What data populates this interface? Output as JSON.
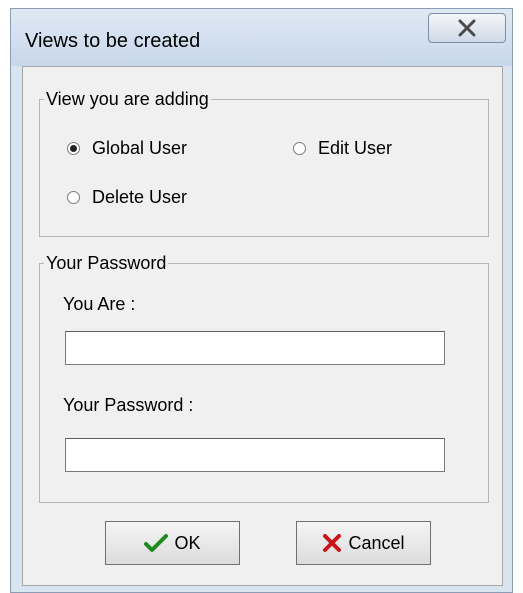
{
  "window": {
    "title": "Views to be created",
    "close_icon": "close-x-icon"
  },
  "view_group": {
    "legend": "View you are adding",
    "options": [
      {
        "label": "Global User",
        "selected": true
      },
      {
        "label": "Edit User",
        "selected": false
      },
      {
        "label": "Delete User",
        "selected": false
      }
    ]
  },
  "password_group": {
    "legend": "Your Password",
    "you_are_label": "You Are :",
    "you_are_value": "",
    "password_label": "Your Password :",
    "password_value": ""
  },
  "buttons": {
    "ok_label": "OK",
    "ok_icon": "green-check-icon",
    "cancel_label": "Cancel",
    "cancel_icon": "red-x-icon"
  },
  "colors": {
    "ok_icon": "#1f8a1f",
    "cancel_icon": "#c8141a"
  }
}
